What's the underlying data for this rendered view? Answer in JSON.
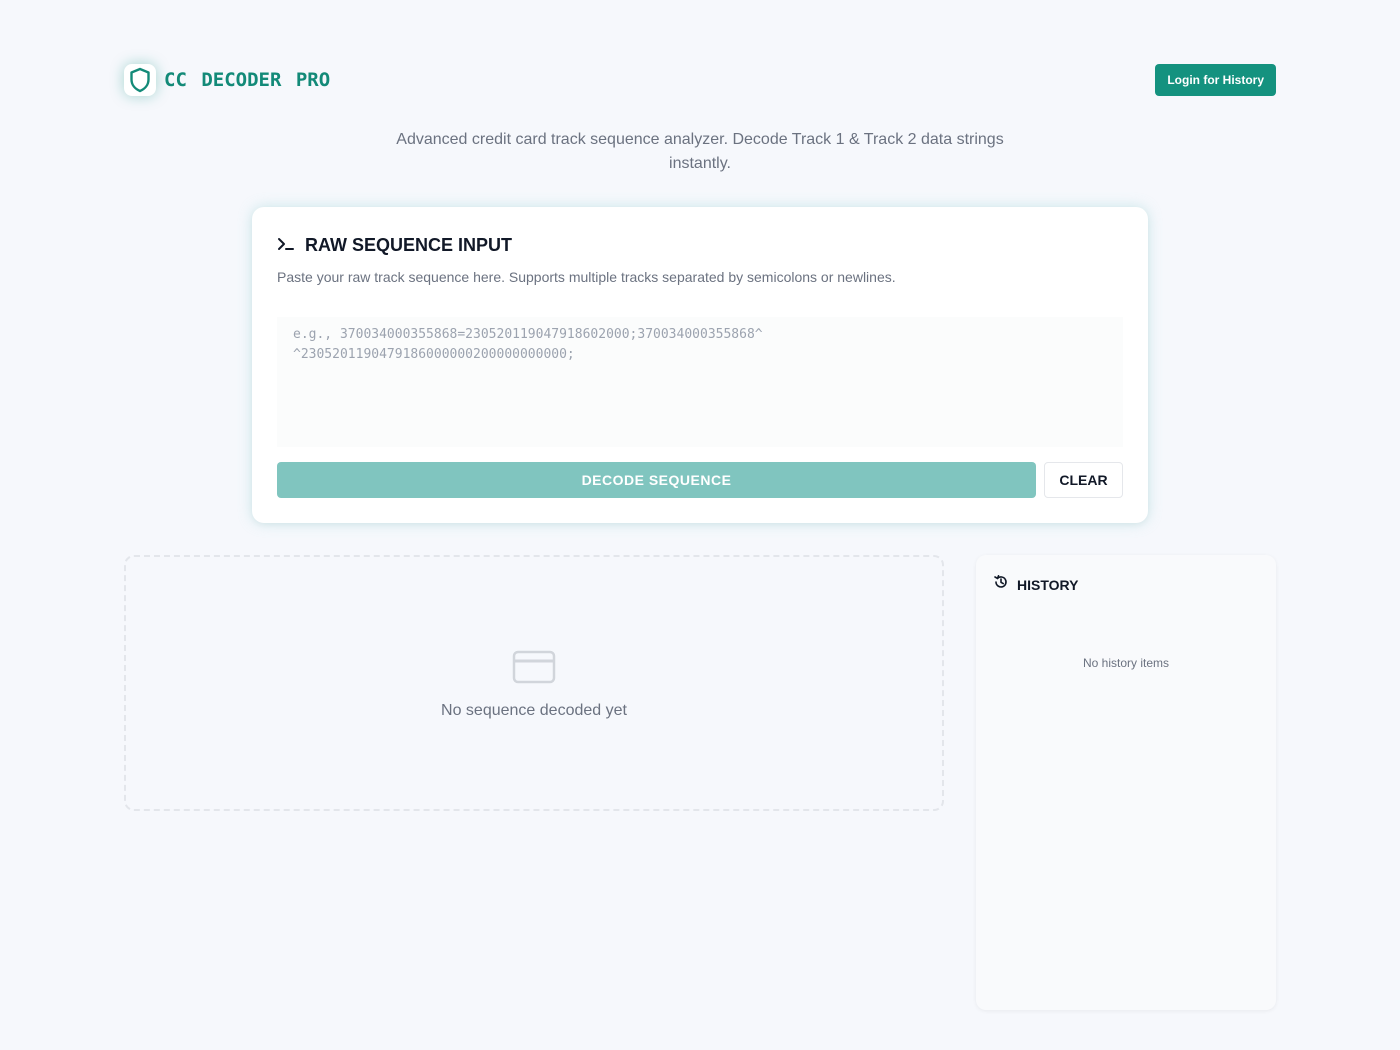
{
  "header": {
    "brand": "CC  DECODER  PRO",
    "login_label": "Login for History"
  },
  "subtitle": "Advanced credit card track sequence analyzer. Decode Track 1 & Track 2 data strings instantly.",
  "input_card": {
    "icon": "terminal-prompt-icon",
    "title": "RAW SEQUENCE INPUT",
    "description": "Paste your raw track sequence here. Supports multiple tracks separated by semicolons or newlines.",
    "placeholder": "e.g., 370034000355868=230520119047918602000;370034000355868^\n^2305201190479186000000200000000000;",
    "value": "",
    "decode_label": "DECODE SEQUENCE",
    "clear_label": "CLEAR"
  },
  "result": {
    "icon": "credit-card-icon",
    "empty_text": "No sequence decoded yet"
  },
  "history": {
    "icon": "history-icon",
    "title": "HISTORY",
    "empty_text": "No history items"
  },
  "colors": {
    "brand": "#138a78",
    "primary_button": "#14927f",
    "decode_button_disabled": "#80c5bf",
    "background": "#f6f8fc"
  }
}
